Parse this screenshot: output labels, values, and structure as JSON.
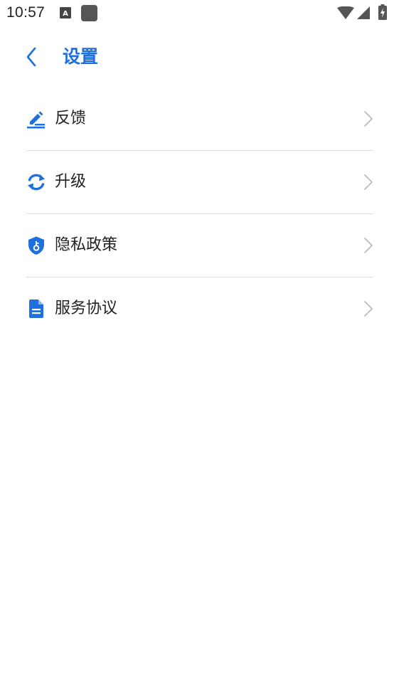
{
  "status_bar": {
    "time": "10:57",
    "icons": [
      "keyboard-icon",
      "notification-icon",
      "wifi-icon",
      "signal-icon",
      "battery-charging-icon"
    ]
  },
  "header": {
    "title": "设置",
    "back_icon": "chevron-left-icon"
  },
  "menu": {
    "items": [
      {
        "label": "反馈",
        "icon": "edit-icon"
      },
      {
        "label": "升级",
        "icon": "refresh-icon"
      },
      {
        "label": "隐私政策",
        "icon": "shield-key-icon"
      },
      {
        "label": "服务协议",
        "icon": "document-icon"
      }
    ],
    "trailing_icon": "chevron-right-icon"
  },
  "colors": {
    "accent": "#1e6fe0",
    "text": "#222222",
    "divider": "#dddddd",
    "chevron": "#bbbbbb"
  }
}
